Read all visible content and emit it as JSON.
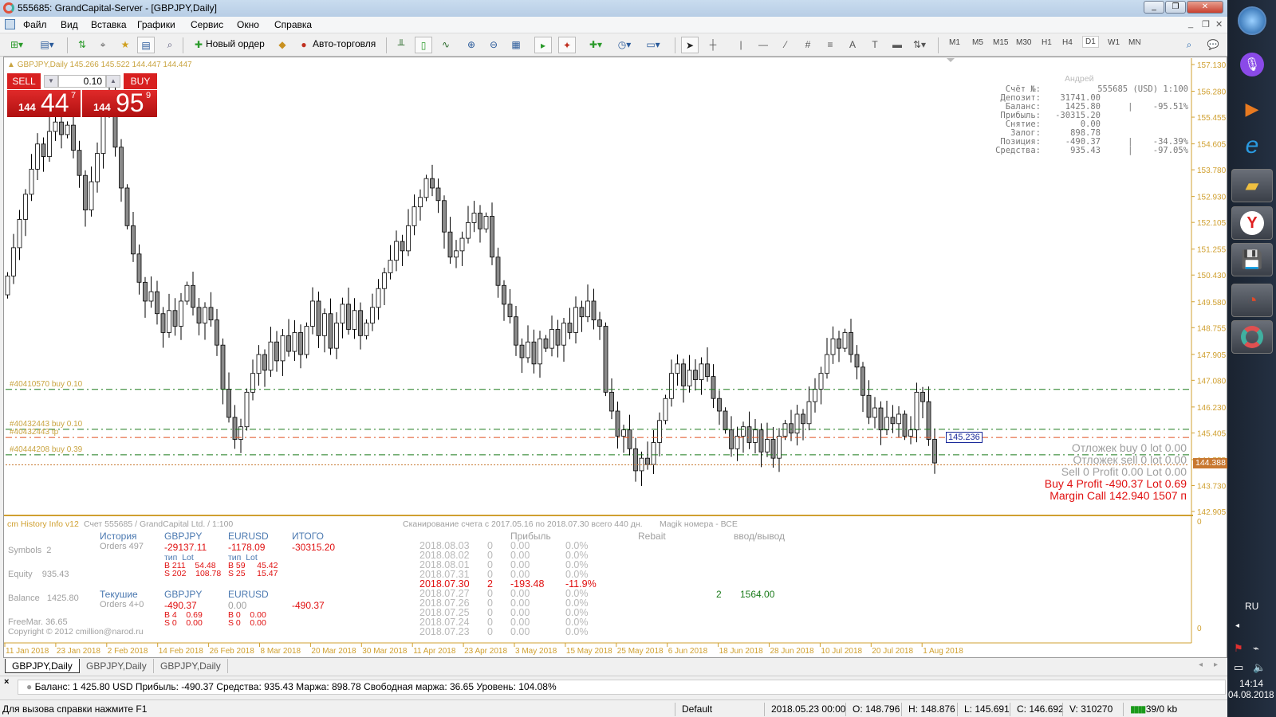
{
  "window": {
    "title": "555685: GrandCapital-Server - [GBPJPY,Daily]",
    "min": "_",
    "restore": "❐",
    "close": "✕"
  },
  "menu": [
    "Файл",
    "Вид",
    "Вставка",
    "Графики",
    "Сервис",
    "Окно",
    "Справка"
  ],
  "toolbar": {
    "new_order": "Новый ордер",
    "auto_trading": "Авто-торговля",
    "timeframes": [
      "M1",
      "M5",
      "M15",
      "M30",
      "H1",
      "H4",
      "D1",
      "W1",
      "MN"
    ],
    "selected_tf": "D1"
  },
  "chart": {
    "header": "GBPJPY,Daily  145.266 145.522 144.447 144.447",
    "trade_panel": {
      "sell": "SELL",
      "buy": "BUY",
      "lot": "0.10",
      "sell_big": "44",
      "sell_small": "144",
      "sell_sup": "7",
      "buy_big": "95",
      "buy_small": "144",
      "buy_sup": "9"
    },
    "account": {
      "name": "Андрей",
      "rows": [
        {
          "label": "Счёт №:",
          "value": "555685 (USD) 1:100",
          "pct": ""
        },
        {
          "label": "Депозит:",
          "value": "31741.00",
          "pct": ""
        },
        {
          "label": "Баланс:",
          "value": "1425.80",
          "pct": "|    -95.51%"
        },
        {
          "label": "Прибыль:",
          "value": "-30315.20",
          "pct": ""
        },
        {
          "label": "Снятие:",
          "value": "0.00",
          "pct": ""
        },
        {
          "label": "Залог:",
          "value": "898.78",
          "pct": ""
        },
        {
          "label": "Позиция:",
          "value": "-490.37",
          "pct": "|    -34.39%"
        },
        {
          "label": "Средства:",
          "value": "935.43",
          "pct": "|    -97.05%"
        }
      ]
    },
    "order_labels": [
      "#40410570 buy 0.10",
      "#40432443 buy 0.10",
      "#40432443 tp",
      "#40444208 buy 0.39"
    ],
    "price_label": "145.236",
    "current_price": "144.388",
    "positions": {
      "pending_buy": "Отложек buy 0   lot 0.00",
      "pending_sell": "Отложек sell 0   lot 0.00",
      "sell": "Sell 0  Profit 0.00  Lot 0.00",
      "buy": "Buy 4  Profit -490.37  Lot 0.69",
      "margin_call": "Margin Call 142.940    1507 п"
    },
    "colors": {
      "buy_line": "#1a7a1a",
      "tp_line": "#e05020",
      "price_line": "#c87830",
      "axis": "#d0a030"
    }
  },
  "chart_data": {
    "type": "candlestick",
    "title": "GBPJPY,Daily",
    "ylim": [
      142.905,
      157.13
    ],
    "y_ticks": [
      "157.130",
      "156.280",
      "155.455",
      "154.605",
      "153.780",
      "152.930",
      "152.105",
      "151.255",
      "150.430",
      "149.580",
      "148.755",
      "147.905",
      "147.080",
      "146.230",
      "145.405",
      "144.555",
      "143.730",
      "142.905"
    ],
    "x_ticks": [
      "11 Jan 2018",
      "23 Jan 2018",
      "2 Feb 2018",
      "14 Feb 2018",
      "26 Feb 2018",
      "8 Mar 2018",
      "20 Mar 2018",
      "30 Mar 2018",
      "11 Apr 2018",
      "23 Apr 2018",
      "3 May 2018",
      "15 May 2018",
      "25 May 2018",
      "6 Jun 2018",
      "18 Jun 2018",
      "28 Jun 2018",
      "10 Jul 2018",
      "20 Jul 2018",
      "1 Aug 2018"
    ],
    "horizontal_lines": [
      146.79,
      145.52,
      145.26,
      144.71,
      144.388
    ],
    "closes": [
      150.4,
      151.3,
      152.2,
      153.0,
      153.8,
      154.6,
      154.2,
      155.0,
      155.3,
      154.9,
      155.2,
      154.4,
      153.6,
      152.5,
      153.4,
      154.3,
      155.6,
      156.2,
      154.5,
      153.2,
      152.0,
      151.1,
      150.2,
      149.6,
      149.9,
      149.2,
      148.6,
      149.3,
      148.8,
      149.6,
      150.1,
      149.4,
      148.9,
      149.4,
      149.0,
      148.2,
      146.8,
      145.9,
      145.2,
      145.6,
      146.7,
      147.3,
      147.9,
      147.4,
      148.3,
      147.7,
      148.5,
      148.0,
      148.6,
      147.9,
      148.8,
      149.6,
      148.5,
      149.2,
      148.1,
      148.9,
      149.5,
      148.7,
      149.3,
      148.5,
      148.9,
      149.4,
      150.0,
      150.5,
      150.9,
      151.5,
      151.2,
      152.0,
      152.6,
      152.9,
      153.5,
      153.2,
      152.8,
      151.8,
      151.0,
      151.2,
      151.6,
      152.1,
      152.4,
      151.9,
      152.3,
      151.0,
      150.1,
      149.5,
      149.1,
      148.2,
      147.8,
      148.3,
      147.6,
      148.4,
      148.1,
      148.7,
      148.2,
      148.9,
      148.6,
      149.4,
      149.1,
      149.6,
      149.0,
      148.8,
      146.7,
      146.1,
      145.3,
      145.5,
      144.9,
      144.2,
      144.6,
      144.4,
      145.1,
      145.8,
      146.5,
      147.3,
      147.6,
      146.9,
      147.4,
      147.1,
      147.6,
      147.2,
      146.5,
      146.1,
      145.5,
      144.9,
      145.3,
      145.6,
      145.1,
      145.5,
      144.8,
      145.2,
      144.6,
      145.3,
      145.7,
      145.4,
      146.0,
      145.7,
      146.4,
      146.8,
      147.3,
      147.9,
      148.4,
      148.1,
      148.6,
      147.9,
      147.5,
      146.6,
      145.9,
      146.2,
      145.5,
      145.9,
      145.7,
      146.0,
      145.3,
      145.5,
      146.7,
      146.4,
      145.2,
      144.45
    ]
  },
  "indicator": {
    "name": "cm History Info v12",
    "account": "Счет 555685 / GrandCapital Ltd. / 1:100",
    "scan": "Сканирование счета с 2017.05.16 по 2018.07.30 всего 440 дн.",
    "magic": "Magik номера - ВСЕ",
    "stats": [
      "Symbols  2",
      "Equity    935.43",
      "Balance   1425.80",
      "FreeMar. 36.65"
    ],
    "history": {
      "title": "История",
      "orders": "Orders 497",
      "gbp": "GBPJPY",
      "eur": "EURUSD",
      "total_label": "ИТОГО",
      "gbp_val": "-29137.11",
      "eur_val": "-1178.09",
      "total": "-30315.20",
      "type_hdr": "тип  Lot",
      "gbp_b": "B 211    54.48",
      "gbp_s": "S 202    108.78",
      "eur_b": "B 59     45.42",
      "eur_s": "S 25     15.47"
    },
    "current": {
      "title": "Текушие",
      "orders": "Orders 4+0",
      "gbp": "GBPJPY",
      "eur": "EURUSD",
      "gbp_val": "-490.37",
      "eur_val": "0.00",
      "total": "-490.37",
      "gbp_b": "B 4    0.69",
      "gbp_s": "S 0    0.00",
      "eur_b": "B 0    0.00",
      "eur_s": "S 0    0.00"
    },
    "copyright": "Copyright © 2012 cmillion@narod.ru",
    "hdr_profit": "Прибыль",
    "hdr_rebait": "Rebait",
    "hdr_io": "ввод/вывод",
    "rows": [
      {
        "date": "2018.08.03",
        "n": "0",
        "p": "0.00",
        "pct": "0.0%"
      },
      {
        "date": "2018.08.02",
        "n": "0",
        "p": "0.00",
        "pct": "0.0%"
      },
      {
        "date": "2018.08.01",
        "n": "0",
        "p": "0.00",
        "pct": "0.0%"
      },
      {
        "date": "2018.07.31",
        "n": "0",
        "p": "0.00",
        "pct": "0.0%"
      },
      {
        "date": "2018.07.30",
        "n": "2",
        "p": "-193.48",
        "pct": "-11.9%"
      },
      {
        "date": "2018.07.27",
        "n": "0",
        "p": "0.00",
        "pct": "0.0%"
      },
      {
        "date": "2018.07.26",
        "n": "0",
        "p": "0.00",
        "pct": "0.0%"
      },
      {
        "date": "2018.07.25",
        "n": "0",
        "p": "0.00",
        "pct": "0.0%"
      },
      {
        "date": "2018.07.24",
        "n": "0",
        "p": "0.00",
        "pct": "0.0%"
      },
      {
        "date": "2018.07.23",
        "n": "0",
        "p": "0.00",
        "pct": "0.0%"
      }
    ],
    "io_count": "2",
    "io_value": "1564.00",
    "scale": "0"
  },
  "tabs": [
    "GBPJPY,Daily",
    "GBPJPY,Daily",
    "GBPJPY,Daily"
  ],
  "terminal": "Баланс: 1 425.80 USD  Прибыль: -490.37  Средства: 935.43  Маржа: 898.78  Свободная маржа: 36.65  Уровень: 104.08%",
  "statusbar": {
    "help": "Для вызова справки нажмите F1",
    "profile": "Default",
    "datetime": "2018.05.23 00:00",
    "open": "O: 148.796",
    "high": "H: 148.876",
    "low": "L: 145.691",
    "close": "C: 146.692",
    "volume": "V: 310270",
    "traffic": "39/0 kb"
  },
  "tray": {
    "lang": "RU",
    "time": "14:14",
    "date": "04.08.2018"
  }
}
